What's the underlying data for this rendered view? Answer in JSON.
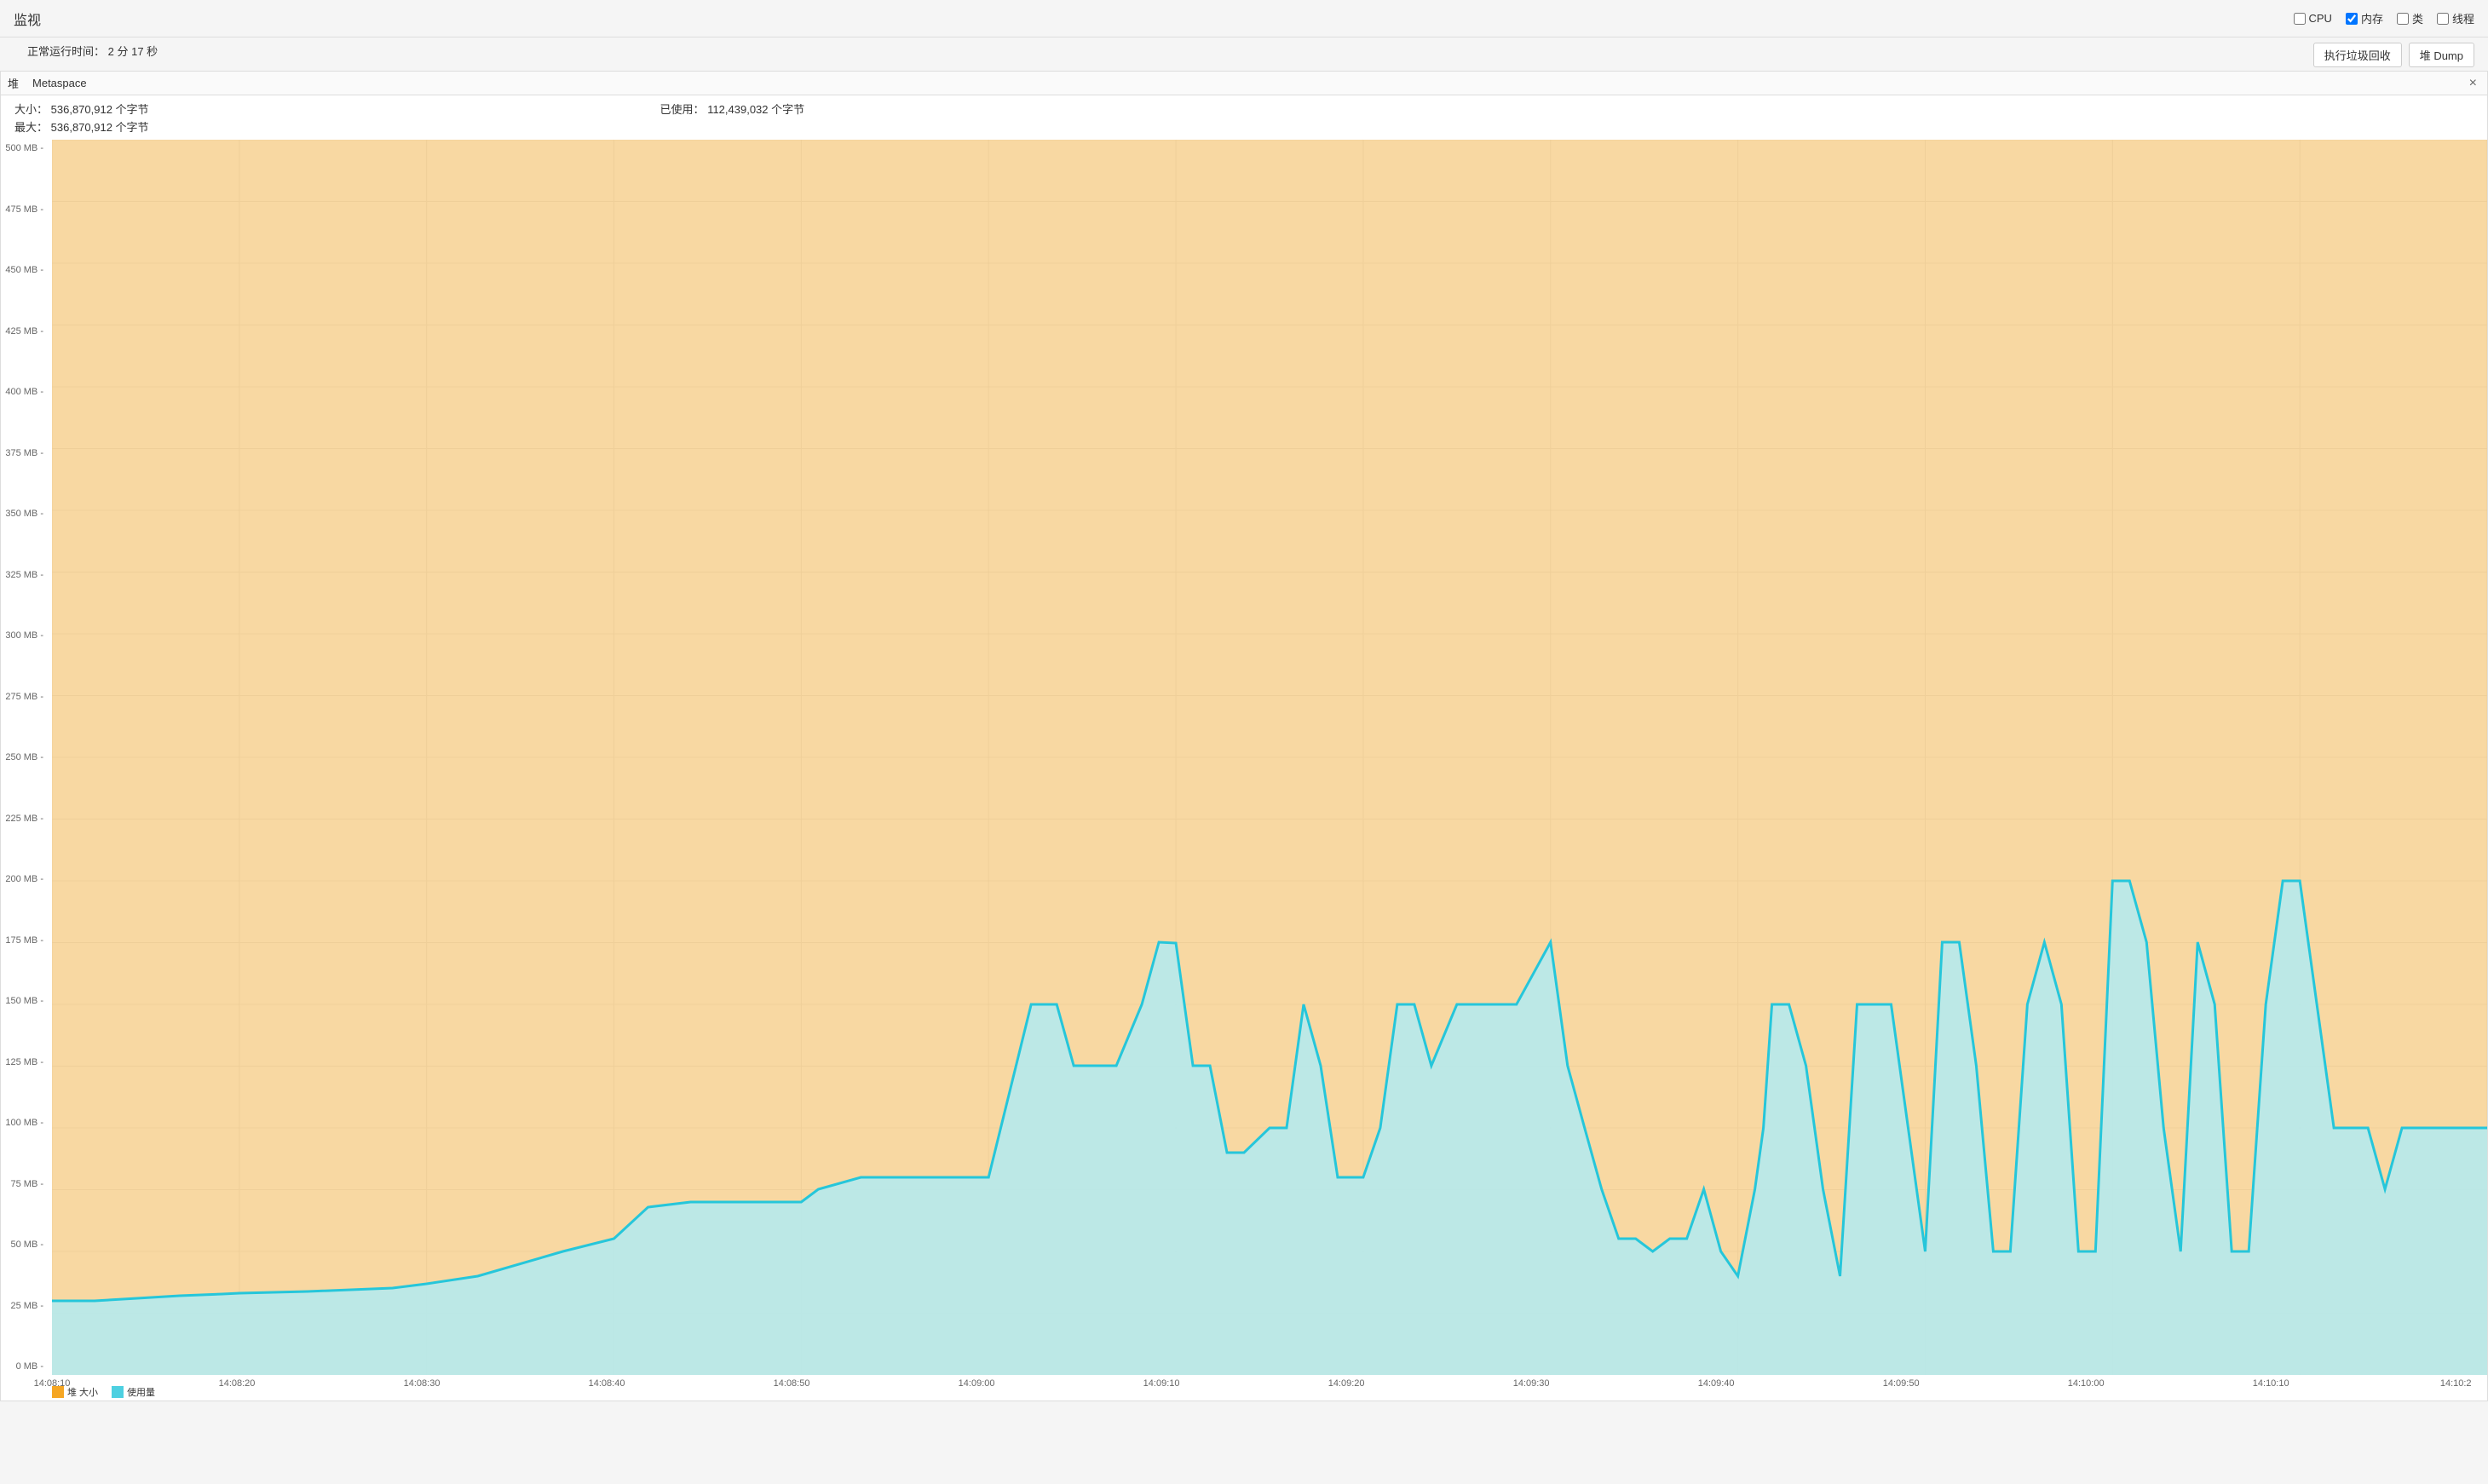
{
  "header": {
    "title": "监视",
    "uptime_label": "正常运行时间：",
    "uptime_value": "2 分 17 秒"
  },
  "checkboxes": [
    {
      "id": "cpu",
      "label": "CPU",
      "checked": false
    },
    {
      "id": "memory",
      "label": "内存",
      "checked": true
    },
    {
      "id": "class",
      "label": "类",
      "checked": false
    },
    {
      "id": "thread",
      "label": "线程",
      "checked": false
    }
  ],
  "buttons": {
    "gc": "执行垃圾回收",
    "heap_dump": "堆 Dump"
  },
  "heap": {
    "label": "堆",
    "tab": "Metaspace",
    "size_label": "大小：",
    "size_value": "536,870,912 个字节",
    "max_label": "最大：",
    "max_value": "536,870,912 个字节",
    "used_label": "已使用：",
    "used_value": "112,439,032 个字节"
  },
  "y_axis": {
    "labels": [
      "0 MB",
      "25 MB",
      "50 MB",
      "75 MB",
      "100 MB",
      "125 MB",
      "150 MB",
      "175 MB",
      "200 MB",
      "225 MB",
      "250 MB",
      "275 MB",
      "300 MB",
      "325 MB",
      "350 MB",
      "375 MB",
      "400 MB",
      "425 MB",
      "450 MB",
      "475 MB",
      "500 MB"
    ]
  },
  "x_axis": {
    "labels": [
      "14:08:10",
      "14:08:20",
      "14:08:30",
      "14:08:40",
      "14:08:50",
      "14:09:00",
      "14:09:10",
      "14:09:20",
      "14:09:30",
      "14:09:40",
      "14:09:50",
      "14:10:00",
      "14:10:10",
      "14:10:2"
    ]
  },
  "legend": [
    {
      "id": "size",
      "label": "堆 大小",
      "color": "#f5a623"
    },
    {
      "id": "used",
      "label": "使用量",
      "color": "#4dd0e1"
    }
  ],
  "colors": {
    "orange_fill": "#f5c87a",
    "orange_line": "#f5a623",
    "blue_fill": "#b2ebf2",
    "blue_line": "#26c6da",
    "grid": "#e0e0e0",
    "background": "#fff"
  }
}
